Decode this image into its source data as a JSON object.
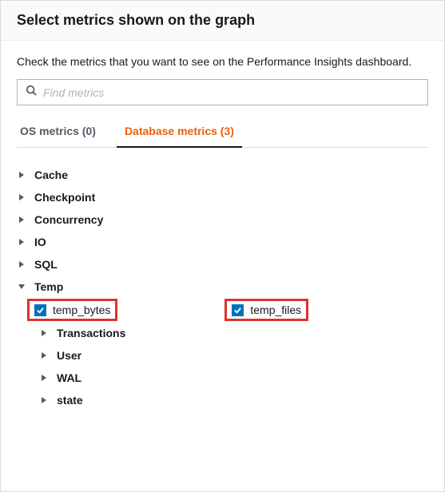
{
  "header": {
    "title": "Select metrics shown on the graph"
  },
  "description": "Check the metrics that you want to see on the Performance Insights dashboard.",
  "search": {
    "placeholder": "Find metrics"
  },
  "tabs": {
    "os": "OS metrics (0)",
    "db": "Database metrics (3)"
  },
  "categories": {
    "cache": "Cache",
    "checkpoint": "Checkpoint",
    "concurrency": "Concurrency",
    "io": "IO",
    "sql": "SQL",
    "temp": "Temp",
    "transactions": "Transactions",
    "user": "User",
    "wal": "WAL",
    "state": "state"
  },
  "metrics": {
    "temp_bytes": "temp_bytes",
    "temp_files": "temp_files"
  }
}
